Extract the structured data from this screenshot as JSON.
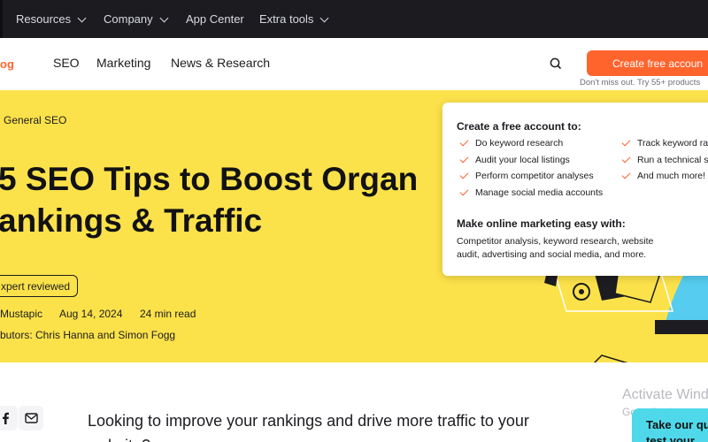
{
  "topbar": {
    "items": [
      {
        "label": "Resources"
      },
      {
        "label": "Company"
      },
      {
        "label": "App Center"
      },
      {
        "label": "Extra tools"
      }
    ]
  },
  "header": {
    "logo_text": "og",
    "nav": [
      {
        "label": "SEO"
      },
      {
        "label": "Marketing"
      },
      {
        "label": "News & Research"
      }
    ],
    "search_icon": "search-icon",
    "cta_label": "Create free accoun",
    "cta_note": "Don't miss out. Try 55+ products"
  },
  "hero": {
    "breadcrumb": "General SEO",
    "title_line1": "5 SEO Tips to Boost Organ",
    "title_line2": "ankings & Traffic",
    "badge": "xpert reviewed",
    "author": "Mustapic",
    "date": "Aug 14, 2024",
    "read_time": "24 min read",
    "contributors": "butors: Chris Hanna and Simon Fogg"
  },
  "popup": {
    "heading": "Create a free account to:",
    "features_left": [
      "Do keyword research",
      "Audit your local listings",
      "Perform competitor analyses",
      "Manage social media accounts"
    ],
    "features_right": [
      "Track keyword ra",
      "Run a technical s",
      "And much more!"
    ],
    "subheading": "Make online marketing easy with:",
    "description": "Competitor analysis, keyword research, website audit, advertising and social media, and more."
  },
  "article": {
    "lead": "Looking to improve your rankings and drive more traffic to your website?"
  },
  "share_icons": [
    "facebook-icon",
    "email-icon"
  ],
  "windows_watermark": {
    "line1": "Activate Windo",
    "line2": "Go to Settings to"
  },
  "chat_widget": {
    "line1": "Take our qui",
    "line2": "test your"
  },
  "colors": {
    "accent": "#ff642d",
    "hero_bg": "#fce24a",
    "topbar_bg": "#1b1b20",
    "chat_bg": "#4fd8ea"
  }
}
